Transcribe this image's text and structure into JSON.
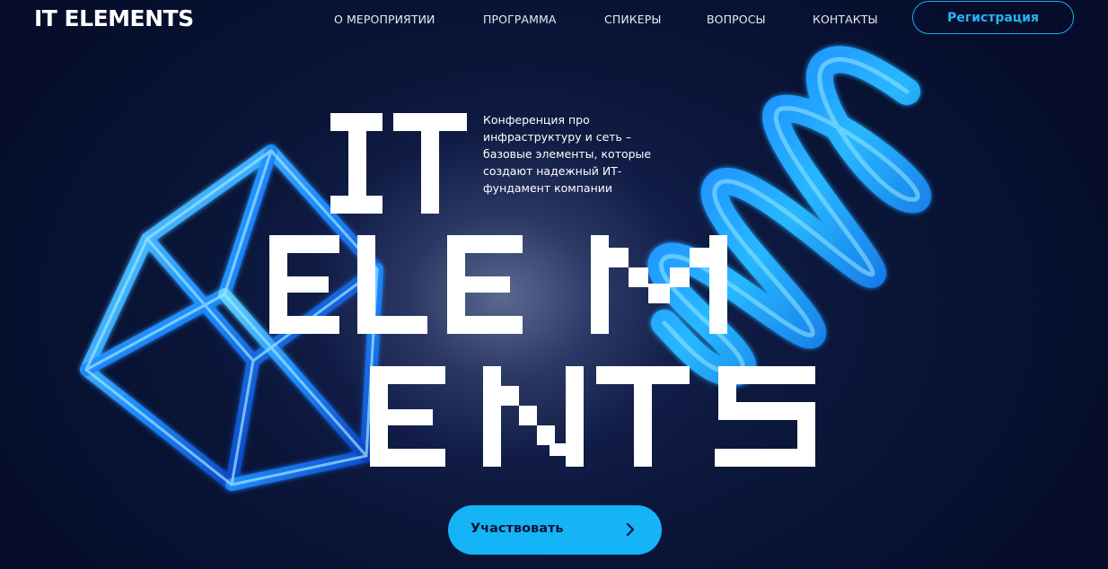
{
  "header": {
    "logo": "IT ELEMENTS",
    "nav": [
      {
        "label": "О МЕРОПРИЯТИИ"
      },
      {
        "label": "ПРОГРАММА"
      },
      {
        "label": "СПИКЕРЫ"
      },
      {
        "label": "ВОПРОСЫ"
      },
      {
        "label": "КОНТАКТЫ"
      }
    ],
    "register_label": "Регистрация"
  },
  "hero": {
    "tagline": "Конференция про инфраструктуру и сеть – базовые элементы, которые создают надежный ИТ-фундамент компании",
    "title_lines": [
      "IT",
      "ELEM",
      "ENTS"
    ],
    "cta_label": "Участвовать",
    "cta_icon": "chevron-right-icon"
  },
  "colors": {
    "background": "#050d2a",
    "accent": "#14b4f7",
    "accent_outline": "#1fa8f0",
    "text": "#ffffff"
  }
}
